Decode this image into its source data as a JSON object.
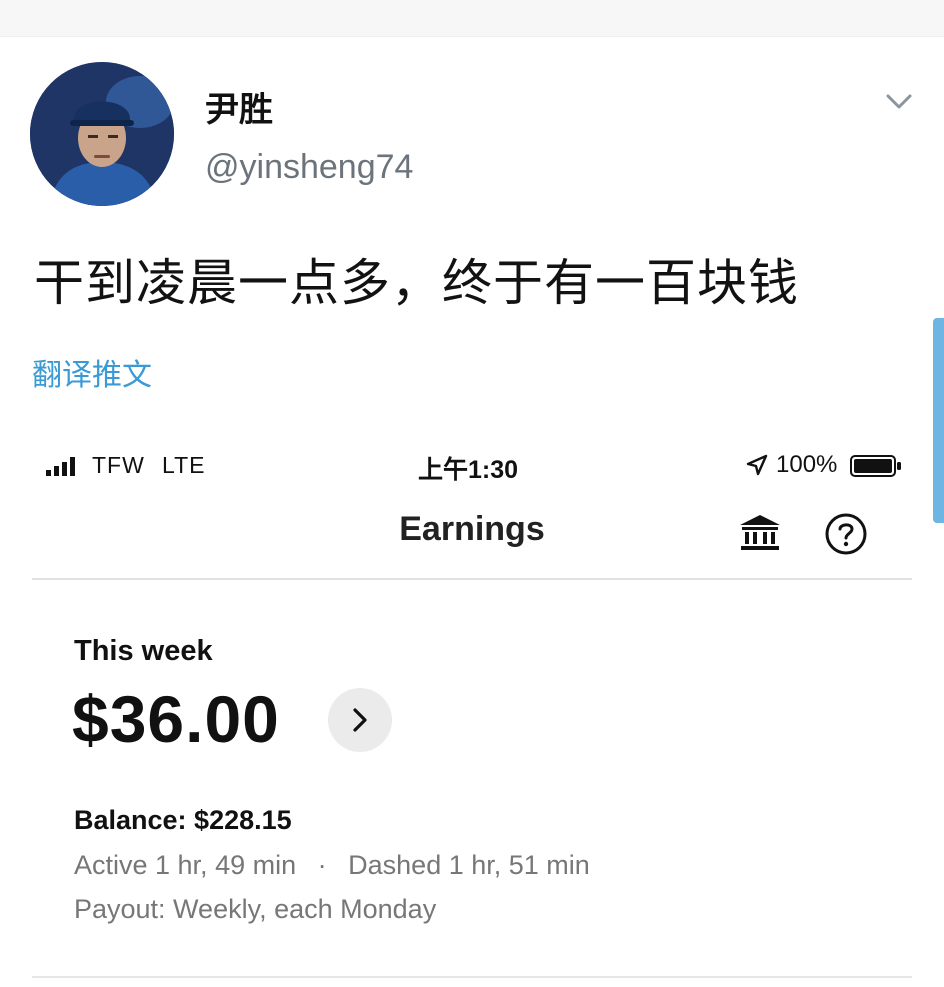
{
  "tweet": {
    "author_name": "尹胜",
    "author_handle": "@yinsheng74",
    "text": "干到凌晨一点多，终于有一百块钱",
    "translate_label": "翻译推文",
    "menu_icon": "chevron-down-icon",
    "avatar": "avatar"
  },
  "screenshot": {
    "status_bar": {
      "carrier": "TFW",
      "network": "LTE",
      "time": "上午1:30",
      "battery": "100%",
      "icons": [
        "signal-icon",
        "location-arrow-icon",
        "battery-icon"
      ]
    },
    "header": {
      "title": "Earnings",
      "icons": [
        "bank-icon",
        "help-icon"
      ]
    },
    "earnings": {
      "week_label": "This week",
      "week_amount": "$36.00",
      "balance": "Balance: $228.15",
      "active_time": "Active 1 hr, 49 min",
      "separator": "·",
      "dashed_time": "Dashed 1 hr, 51 min",
      "payout": "Payout: Weekly, each Monday"
    }
  },
  "colors": {
    "link": "#3a9ad6",
    "text": "#111111",
    "secondary_text": "#777777",
    "handle": "#6b737b",
    "scrollbar": "#6db6e4"
  }
}
